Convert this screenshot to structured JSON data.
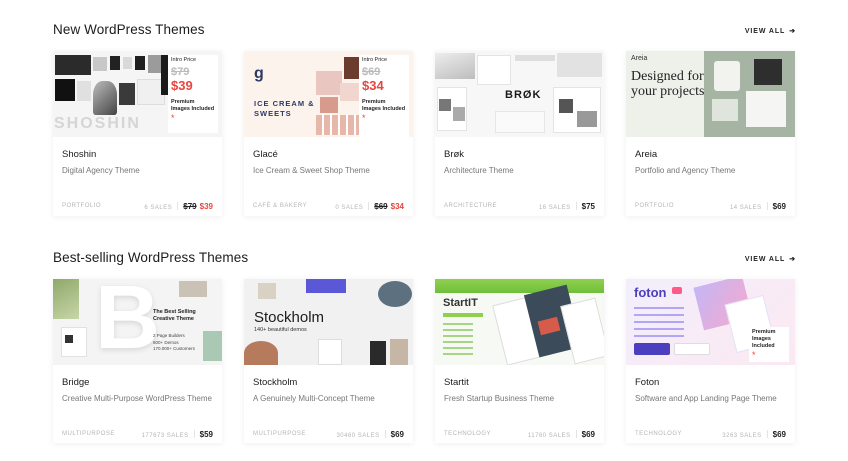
{
  "sections": [
    {
      "title": "New WordPress Themes",
      "view_all": "VIEW ALL",
      "cards": [
        {
          "name": "Shoshin",
          "desc": "Digital Agency Theme",
          "category": "PORTFOLIO",
          "sales": "6 SALES",
          "old_price": "$79",
          "price": "$39",
          "promo": {
            "intro": "Intro Price",
            "old": "$79",
            "new": "$39",
            "premium": "Premium Images Included",
            "star": "*"
          },
          "art_text": "SHOSHIN"
        },
        {
          "name": "Glacé",
          "desc": "Ice Cream & Sweet Shop Theme",
          "category": "CAFÉ & BAKERY",
          "sales": "0 SALES",
          "old_price": "$69",
          "price": "$34",
          "promo": {
            "intro": "Intro Price",
            "old": "$69",
            "new": "$34",
            "premium": "Premium Images Included",
            "star": "*"
          },
          "art_text": "ICE CREAM & SWEETS",
          "art_logo": "g"
        },
        {
          "name": "Brøk",
          "desc": "Architecture Theme",
          "category": "ARCHITECTURE",
          "sales": "16 SALES",
          "price": "$75",
          "art_text": "BRØK"
        },
        {
          "name": "Areia",
          "desc": "Portfolio and Agency Theme",
          "category": "PORTFOLIO",
          "sales": "14 SALES",
          "price": "$69",
          "art_brand": "Areia",
          "art_text": "Designed for your projects"
        }
      ]
    },
    {
      "title": "Best-selling WordPress Themes",
      "view_all": "VIEW ALL",
      "cards": [
        {
          "name": "Bridge",
          "desc": "Creative Multi-Purpose WordPress Theme",
          "category": "MULTIPURPOSE",
          "sales": "177673 SALES",
          "price": "$59",
          "art_letter": "B",
          "art_title": "The Best Selling Creative Theme",
          "art_lines": [
            "2 Page Builders",
            "600+ Demos",
            "170.000+ Customers"
          ]
        },
        {
          "name": "Stockholm",
          "desc": "A Genuinely Multi-Concept Theme",
          "category": "MULTIPURPOSE",
          "sales": "30460 SALES",
          "price": "$69",
          "art_text": "Stockholm",
          "art_sub": "140+ beautiful demos"
        },
        {
          "name": "Startit",
          "desc": "Fresh Startup Business Theme",
          "category": "TECHNOLOGY",
          "sales": "11760 SALES",
          "price": "$69",
          "art_text": "StartIT"
        },
        {
          "name": "Foton",
          "desc": "Software and App Landing Page Theme",
          "category": "TECHNOLOGY",
          "sales": "3263 SALES",
          "price": "$69",
          "art_text": "foton",
          "promo": {
            "premium": "Premium Images Included",
            "star": "*"
          }
        }
      ]
    }
  ],
  "colors": {
    "sale": "#e8463f",
    "text": "#1c1c1c",
    "muted": "#777777"
  }
}
